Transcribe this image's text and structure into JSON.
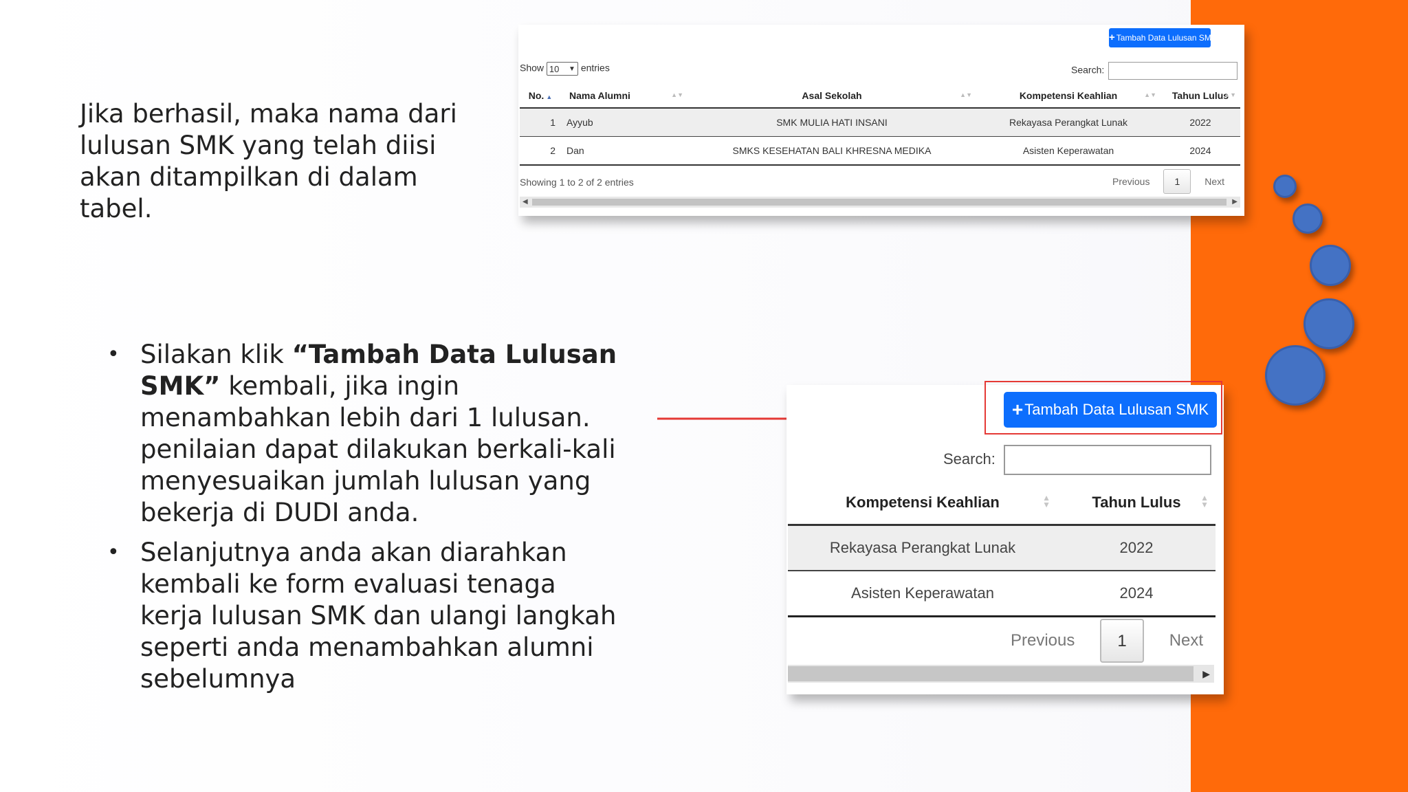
{
  "slide": {
    "intro_text": "Jika berhasil, maka nama dari lulusan SMK yang telah diisi akan ditampilkan di dalam tabel.",
    "bullets": [
      {
        "bullet_symbol": "•",
        "text_before": "Silakan klik ",
        "bold": "“Tambah Data Lulusan SMK”",
        "text_after": " kembali, jika ingin menambahkan lebih dari 1 lulusan. penilaian dapat dilakukan berkali-kali menyesuaikan jumlah lulusan yang bekerja di DUDI anda."
      },
      {
        "bullet_symbol": "•",
        "text": "Selanjutnya anda akan diarahkan kembali ke form evaluasi tenaga kerja lulusan SMK dan ulangi langkah seperti anda menambahkan alumni sebelumnya"
      }
    ],
    "colors": {
      "accent_orange": "#ff6a0a",
      "bubble_blue": "#4472c4",
      "button_blue": "#0d6efd",
      "arrow_red": "#e53935"
    }
  },
  "table_screenshot": {
    "add_button_label": "Tambah Data Lulusan SMK",
    "add_button_icon": "plus-icon",
    "show_label": "Show",
    "entries_value": "10",
    "entries_label": "entries",
    "search_label": "Search:",
    "columns": [
      "No.",
      "Nama Alumni",
      "Asal Sekolah",
      "Kompetensi Keahlian",
      "Tahun Lulus"
    ],
    "rows": [
      [
        "1",
        "Ayyub",
        "SMK MULIA HATI INSANI",
        "Rekayasa Perangkat Lunak",
        "2022"
      ],
      [
        "2",
        "Dan",
        "SMKS KESEHATAN BALI KHRESNA MEDIKA",
        "Asisten Keperawatan",
        "2024"
      ]
    ],
    "info_text": "Showing 1 to 2 of 2 entries",
    "pagination": {
      "previous": "Previous",
      "current_page": "1",
      "next": "Next"
    }
  },
  "zoom_screenshot": {
    "add_button_label": "Tambah Data Lulusan SMK",
    "search_label": "Search:",
    "columns": [
      "Kompetensi Keahlian",
      "Tahun Lulus"
    ],
    "rows": [
      [
        "Rekayasa Perangkat Lunak",
        "2022"
      ],
      [
        "Asisten Keperawatan",
        "2024"
      ]
    ],
    "pagination": {
      "previous": "Previous",
      "current_page": "1",
      "next": "Next"
    }
  }
}
